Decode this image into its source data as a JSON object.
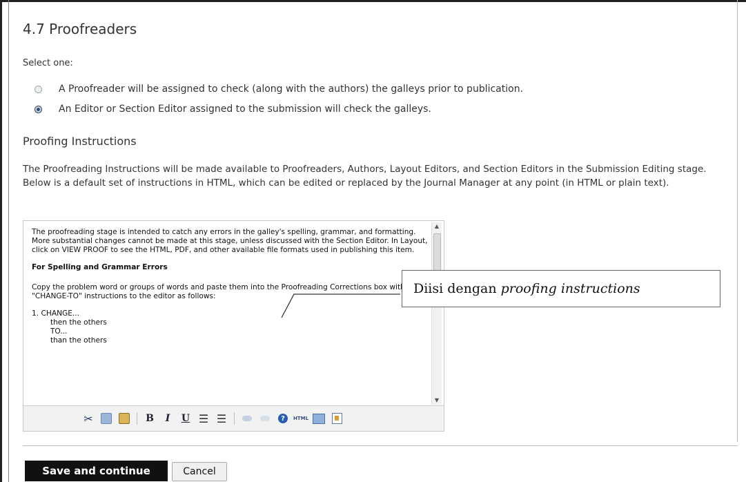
{
  "section_title": "4.7 Proofreaders",
  "select_label": "Select one:",
  "options": [
    {
      "label": "A Proofreader will be assigned to check (along with the authors) the galleys prior to publication.",
      "checked": false
    },
    {
      "label": "An Editor or Section Editor assigned to the submission will check the galleys.",
      "checked": true
    }
  ],
  "instructions_heading": "Proofing Instructions",
  "instructions_text": "The Proofreading Instructions will be made available to Proofreaders, Authors, Layout Editors, and Section Editors in the Submission Editing stage. Below is a default set of instructions in HTML, which can be edited or replaced by the Journal Manager at any point (in HTML or plain text).",
  "editor": {
    "para1": "The proofreading stage is intended to catch any errors in the galley's spelling, grammar, and formatting. More substantial changes cannot be made at this stage, unless discussed with the Section Editor. In Layout, click on VIEW PROOF to see the HTML, PDF, and other available file formats used in publishing this item.",
    "heading": "For Spelling and Grammar Errors",
    "para2": "Copy the problem word or groups of words and paste them into the Proofreading Corrections box with \"CHANGE-TO\" instructions to the editor as follows:",
    "list": [
      "1. CHANGE...",
      "        then the others",
      "        TO...",
      "        than the others"
    ]
  },
  "toolbar_icons": [
    "cut-icon",
    "copy-icon",
    "paste-icon",
    "bold-icon",
    "italic-icon",
    "underline-icon",
    "bullet-list-icon",
    "numbered-list-icon",
    "link-icon",
    "unlink-icon",
    "help-icon",
    "html-icon",
    "fullscreen-icon",
    "image-icon"
  ],
  "toolbar_glyphs": {
    "cut": "✂",
    "bold": "B",
    "italic": "I",
    "underline": "U",
    "bullets": "☰",
    "numbers": "☰",
    "help": "?",
    "html": "HTML"
  },
  "callout": {
    "text": "Diisi dengan",
    "emphasis": "proofing instructions"
  },
  "buttons": {
    "save": "Save and continue",
    "cancel": "Cancel"
  },
  "scroll": {
    "up": "▲",
    "down": "▼"
  },
  "colors": {
    "save_bg": "#111111",
    "save_text": "#ffffff",
    "radio_checked": "#2c4a7a"
  }
}
